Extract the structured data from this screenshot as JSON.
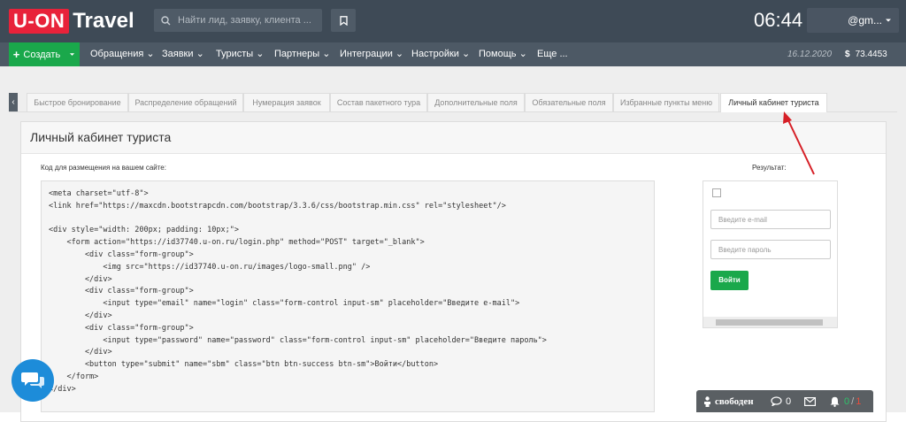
{
  "header": {
    "logo_box": "U-ON",
    "logo_rest": "Travel",
    "search_placeholder": "Найти лид, заявку, клиента ...",
    "clock": "06:44",
    "user": "@gm..."
  },
  "menu": {
    "create_label": "Создать",
    "items": [
      "Обращения",
      "Заявки",
      "Туристы",
      "Партнеры",
      "Интеграции",
      "Настройки",
      "Помощь",
      "Еще ..."
    ],
    "date": "16.12.2020",
    "rate": "73.4453"
  },
  "tabs": [
    "Быстрое бронирование",
    "Распределение обращений",
    "Нумерация заявок",
    "Состав пакетного тура",
    "Дополнительные поля",
    "Обязательные поля",
    "Избранные пункты меню",
    "Личный кабинет туриста"
  ],
  "panel": {
    "title": "Личный кабинет туриста",
    "code_label": "Код для размещения на вашем сайте:",
    "result_label": "Результат:",
    "code": "<meta charset=\"utf-8\">\n<link href=\"https://maxcdn.bootstrapcdn.com/bootstrap/3.3.6/css/bootstrap.min.css\" rel=\"stylesheet\"/>\n\n<div style=\"width: 200px; padding: 10px;\">\n    <form action=\"https://id37740.u-on.ru/login.php\" method=\"POST\" target=\"_blank\">\n        <div class=\"form-group\">\n            <img src=\"https://id37740.u-on.ru/images/logo-small.png\" />\n        </div>\n        <div class=\"form-group\">\n            <input type=\"email\" name=\"login\" class=\"form-control input-sm\" placeholder=\"Введите e-mail\">\n        </div>\n        <div class=\"form-group\">\n            <input type=\"password\" name=\"password\" class=\"form-control input-sm\" placeholder=\"Введите пароль\">\n        </div>\n        <button type=\"submit\" name=\"sbm\" class=\"btn btn-success btn-sm\">Войти</button>\n    </form>\n</div>"
  },
  "result": {
    "email_placeholder": "Введите e-mail",
    "password_placeholder": "Введите пароль",
    "login_button": "Войти"
  },
  "status_bar": {
    "status": "свободен",
    "chats": "0",
    "counter_a": "0",
    "counter_sep": "/",
    "counter_b": "1"
  },
  "colors": {
    "topbar": "#3e4a56",
    "logo_red": "#e8223a",
    "create_green": "#1aa84b",
    "arrow_red": "#d61f26",
    "chat_blue": "#1d8cd9"
  }
}
